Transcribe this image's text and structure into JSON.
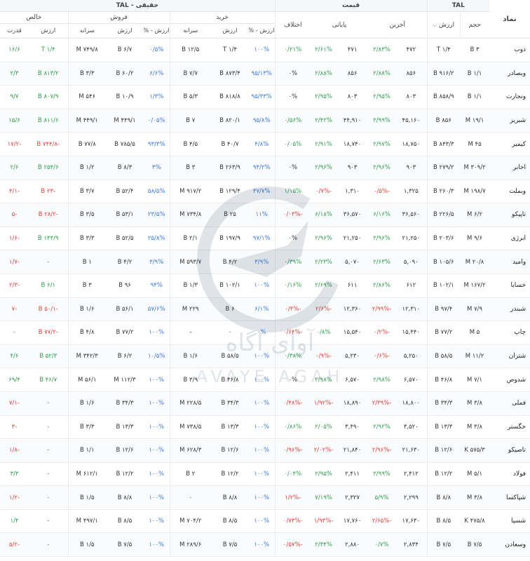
{
  "header": {
    "symbol": "نماد",
    "tal": "TAL",
    "price": "قیمت",
    "real_tal": "حقیقی - TAL",
    "buy": "خرید",
    "sell": "فروش",
    "net": "خالص",
    "volume": "حجم",
    "value": "ارزش",
    "last": "آخرین",
    "close": "پایانی",
    "diff": "اختلاف",
    "value_pct": "ارزش - %",
    "per_capita": "سرانه",
    "power": "قدرت"
  },
  "watermark": {
    "fa": "آوای آگاه",
    "en": "AVAYE AGAH"
  },
  "rows": [
    [
      "ذوب",
      "۳ B",
      "۱/۴ T",
      "۴۷۲",
      "۲/۸۳%",
      "۴۷۱",
      "۲/۶۱%",
      "۰/۲۱%",
      "۱۰۰%",
      "۱/۴ T",
      "۱۲/۵ B",
      "۰/۵%",
      "۶/۷ B",
      "۷۴۹/۸ M",
      "۱/۴ T",
      "۱۶/۶"
    ],
    [
      "وبصادر",
      "۱/۱ B",
      "۹۱۶/۲ B",
      "۸۵۶",
      "۲/۸۸%",
      "۸۵۶",
      "۲/۸۸%",
      "۰%",
      "۹۵/۱۳%",
      "۸۷۳/۴ B",
      "۷/۷ B",
      "۶/۶%",
      "۶۰/۲ B",
      "۳/۳ B",
      "۸۱۳/۲ B",
      "۲/۳"
    ],
    [
      "ونجارت",
      "۱/۱ B",
      "۸۵۸/۹ B",
      "۸۰۳",
      "۲/۹۵%",
      "۸۰۳",
      "۲/۹۵%",
      "۰%",
      "۹۵/۳۳%",
      "۸۱۸/۸ B",
      "۵/۳ B",
      "۱/۳%",
      "۱۰/۹ B",
      "۵۴۶ M",
      "۸۰۷/۹ B",
      "۹/۷"
    ],
    [
      "شبریز",
      "۱۹/۱ M",
      "۸۵۶ B",
      "۴۵,۱۶۰",
      "۲/۹۹%",
      "۴۴,۹۱۰",
      "۲/۴۲%",
      "۰/۵۶%",
      "۹۵/۸%",
      "۸۲۰/۱ B",
      "۷ B",
      "۰/۰۵%",
      "۴۴۹/۱ M",
      "۴۴۹/۱ M",
      "۸۱۱/۶ B",
      "۱۵/۶"
    ],
    [
      "کیمیر",
      "۴۵ M",
      "۸۴۳/۳ B",
      "۱۸,۷۵۰",
      "۲/۹۷%",
      "۱۸,۷۴۰",
      "۲/۹۱%",
      "۰/۰۵%",
      "۴/۸%",
      "۴۰/۷ B",
      "۴/۵ B",
      "۹۳/۳%",
      "۷۸۵/۵ B",
      "۷۷/۸ B",
      "-۷۴۴/۸ B",
      "-۱۷/۲"
    ],
    [
      "اخابر",
      "۳۰۹/۲ M",
      "۲۷۹/۲ B",
      "۹۰۳",
      "۲/۹۶%",
      "۹۰۳",
      "۲/۹۶%",
      "۰%",
      "۹۴/۲%",
      "۲۶۳/۹ B",
      "۳ B",
      "۳%",
      "۸/۳ B",
      "۱/۲ B",
      "۲۵۴/۶ B",
      "۲/۶"
    ],
    [
      "وبملت",
      "۱۹۸/۷ M",
      "۲۶۰/۳ B",
      "۱,۳۲۵",
      "-۰/۵%",
      "۱,۳۱۰",
      "-۰/۷%",
      "۱/۱۵%",
      "۴۷/۷%",
      "۱۲۹/۴ B",
      "۹۱۷/۲ M",
      "۵۸/۵%",
      "۵۲/۴ B",
      "۳/۷ B",
      "-۲۳ B",
      "-۴/۱"
    ],
    [
      "تاپیکو",
      "۶/۲ M",
      "۲۲۶/۵ B",
      "۳۶,۵۶۰",
      "۶/۱۶%",
      "۳۶,۵۷۰",
      "۶/۱۸%",
      "-۰/۰۳%",
      "۱۱%",
      "۲۵ B",
      "۷۳۴/۸ M",
      "۲۳/۵%",
      "۵۳/۱ B",
      "۳/۵ B",
      "-۲۸/۲ B",
      "-۵"
    ],
    [
      "ابرژی",
      "۹/۶ M",
      "۲۰۳/۶ B",
      "۲۱,۲۵۰",
      "۲/۹۶%",
      "۲۱,۲۵۰",
      "۲/۹۶%",
      "۰%",
      "۹۷/۱%",
      "۱۹۷/۹ B",
      "۲/۱ B",
      "۲۵/۸%",
      "۵۲/۵ B",
      "۳/۳ B",
      "۱۴۴/۹ B",
      "-۱/۶"
    ],
    [
      "وامید",
      "۲۰/۸ M",
      "۱۰۵/۶ B",
      "۵,۰۹۰",
      "۲/۶۳%",
      "۵,۰۷۰",
      "۲/۲۳%",
      "۰/۳۹%",
      "۳/۹%",
      "۴/۲ B",
      "۵۹۳/۷ M",
      "۳/۹%",
      "۴/۲ B",
      "۱ B",
      "۰",
      "-۱/۷"
    ],
    [
      "خسابا",
      "۱۶۷/۲ M",
      "۱۰۲/۱ B",
      "۶۱۲",
      "۲/۸۶%",
      "۶۱۱",
      "۲/۶۹%",
      "۰/۱۶%",
      "۱۰۰%",
      "۱۰۲/۱ B",
      "۱/۳ B",
      "۹۴%",
      "۹۶ B",
      "۳ B",
      "۶/۱ B",
      "-۲/۳"
    ],
    [
      "شبندر",
      "۷/۹ M",
      "۹۷/۴ B",
      "۱۲,۳۱۰",
      "-۲/۹۹%",
      "۱۲,۳۶۰",
      "-۲/۶%",
      "-۰/۴%",
      "۶/۱%",
      "۶ B",
      "۲۲۹ M",
      "۵۷/۶%",
      "۵۶/۱ B",
      "۱/۶ B",
      "-۵۰/۱ B",
      "-۷"
    ],
    [
      "چاپ",
      "۵ M",
      "۷۷/۲ B",
      "۱۵,۴۴۰",
      "-۰/۲%",
      "۱۵,۵۴۰",
      "۰/۸%",
      "-۰/۶۴%",
      "۰%",
      "۰",
      "-",
      "۱۰۰%",
      "۷۷/۲ B",
      "۴/۸ B",
      "-۷۷/۲ B",
      "-"
    ],
    [
      "شتران",
      "۱۱/۲ M",
      "۵۸/۵ B",
      "۵,۲۵۰",
      "-۰/۶%",
      "۵,۲۳۰",
      "-۰/۹%",
      "۰/۳۸%",
      "۱۰۰%",
      "۵۸/۵ B",
      "۱/۶ B",
      "۱۰/۵%",
      "۶/۲ B",
      "۳۴۲/۳ M",
      "۵۲/۳ B",
      "۴/۶"
    ],
    [
      "شدوص",
      "۷/۱ M",
      "۴۶/۸ B",
      "۶,۵۷۰",
      "۲/۹۸%",
      "۶,۵۷۰",
      "۲/۹۸%",
      "۰%",
      "۱۰۰%",
      "۴۶/۸ B",
      "۳/۹ B",
      "۱۰۰%",
      "۱۱۲/۳ M",
      "۵۶/۱ M",
      "۴۶/۷ B",
      "۶۹/۴"
    ],
    [
      "فملی",
      "۳/۸ M",
      "۳۴/۳ B",
      "۱۸,۸۰۰",
      "-۲/۳۹%",
      "۱۸,۸۹۰",
      "-۱/۹۲%",
      "-۰/۴۸%",
      "۱۰۰%",
      "۳۴/۳ B",
      "۲۲۸/۵ M",
      "۱۰۰%",
      "۳۴/۳ B",
      "۱/۶ B",
      "۰",
      "-۷/۱"
    ],
    [
      "خگستر",
      "۳/۸ M",
      "۱۳/۳ B",
      "۳,۵۲۰",
      "۲/۹۲%",
      "۳,۴۹۰",
      "۲/۰۵%",
      "۰/۸۶%",
      "۱۰۰%",
      "۱۳/۳ B",
      "۷۳۸/۵ M",
      "۱۰۰%",
      "۱۳/۳ B",
      "۳/۳ B",
      "۰",
      "-۳"
    ],
    [
      "تاصیکو",
      "۵۷۵/۳ K",
      "۱۲/۶ B",
      "۲۱,۶۳۰",
      "-۲/۹۶%",
      "۲۱,۸۴۰",
      "-۲/۰۲%",
      "-۰/۹۶%",
      "۱۰۰%",
      "۱۲/۶ B",
      "۶۲۸/۳ M",
      "۱۰۰%",
      "۱۲/۶ B",
      "۱/۱ B",
      "۰",
      "-۱/۸"
    ],
    [
      "فولاد",
      "۵/۱ M",
      "۱۲/۲ B",
      "۲,۴۱۲",
      "۲/۹۹%",
      "۲,۴۱۱",
      "۲/۹۵%",
      "۰/۰۴%",
      "۱۰۰%",
      "۱۲/۲ B",
      "۲ B",
      "۱۰۰%",
      "۱۲/۲ B",
      "۶۱۲/۱ M",
      "۰",
      "۳/۳"
    ],
    [
      "شپاکسا",
      "۳/۸ M",
      "۸/۸ B",
      "۲,۲۹۹",
      "۵/۹%",
      "۲,۳۲۷",
      "۷/۱۹%",
      "-۱/۲%",
      "۱۰۰%",
      "۸/۸ B",
      "۰",
      "۱۰۰%",
      "۸/۸ B",
      "۱/۵ B",
      "۰",
      "-۱/۲"
    ],
    [
      "شسپا",
      "۴۷۵/۸ K",
      "۸/۵ B",
      "۱۷,۶۳۰",
      "-۲/۶۵%",
      "۱۷,۷۶۰",
      "-۱/۹۳%",
      "-۰/۷۳%",
      "۱۰۰%",
      "۸/۵ B",
      "۷۰۴/۲ M",
      "۱۰۰%",
      "۸/۵ B",
      "۴۹۷/۱ M",
      "۰",
      "۱/۴"
    ],
    [
      "وسعادن",
      "۷/۵ B",
      "۷/۵ B",
      "۲,۸۳۴",
      "۰/۷%",
      "۲,۸۸۰",
      "۲/۳۴%",
      "-۰/۵۷%",
      "۱۰۰%",
      "۷/۵ B",
      "۲۸۹/۶ M",
      "۱۰۰%",
      "۷/۵ B",
      "۱/۵ B",
      "۰",
      "-۵/۲"
    ]
  ],
  "colors": {
    "up": "#2e9e4f",
    "down": "#e0413d",
    "pct": "#3a78d8",
    "text": "#333333"
  }
}
